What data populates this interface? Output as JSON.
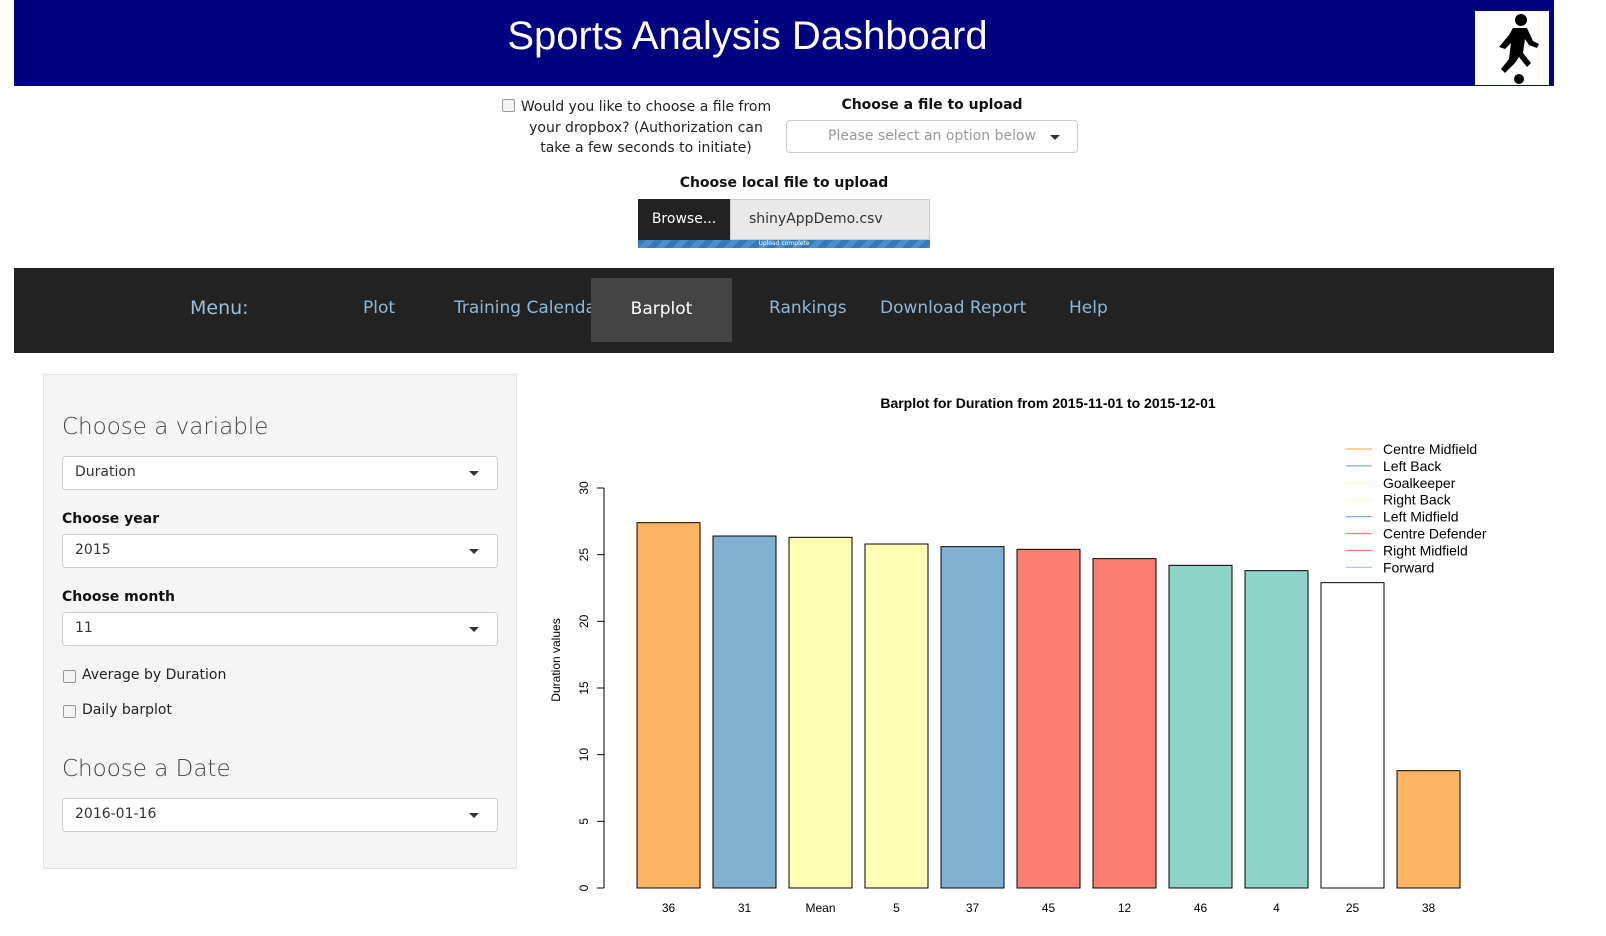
{
  "header": {
    "title": "Sports Analysis Dashboard",
    "logo_icon": "football-player-icon"
  },
  "upload": {
    "dropbox_label": "Would you like to choose a file from your dropbox? (Authorization can take a few seconds to initiate)",
    "dropbox_checked": false,
    "choose_file_label": "Choose a file to upload",
    "choose_file_placeholder": "Please select an option below",
    "local_file_label": "Choose local file to upload",
    "browse_label": "Browse...",
    "file_name": "shinyAppDemo.csv",
    "progress_text": "Upload complete",
    "progress": 1.0
  },
  "nav": {
    "menu_label": "Menu:",
    "items": [
      "Plot",
      "Training Calendar",
      "Barplot",
      "Rankings",
      "Download Report",
      "Help"
    ],
    "active": "Barplot"
  },
  "sidebar": {
    "variable_heading": "Choose a variable",
    "variable_value": "Duration",
    "year_label": "Choose year",
    "year_value": "2015",
    "month_label": "Choose month",
    "month_value": "11",
    "avg_label": "Average by Duration",
    "avg_checked": false,
    "daily_label": "Daily barplot",
    "daily_checked": false,
    "date_heading": "Choose a Date",
    "date_value": "2016-01-16"
  },
  "chart_data": {
    "type": "bar",
    "title": "Barplot for Duration from 2015-11-01 to 2015-12-01",
    "xlabel": "",
    "ylabel": "Duration values",
    "ylim": [
      0,
      30
    ],
    "yticks": [
      0,
      5,
      10,
      15,
      20,
      25,
      30
    ],
    "categories": [
      "36",
      "31",
      "Mean",
      "5",
      "37",
      "45",
      "12",
      "46",
      "4",
      "25",
      "38"
    ],
    "values": [
      27.4,
      26.4,
      26.3,
      25.8,
      25.6,
      25.4,
      24.7,
      24.2,
      23.8,
      22.9,
      8.8
    ],
    "bar_colors": [
      "#FDB462",
      "#80B1D3",
      "#FFFFB3",
      "#FFFFB3",
      "#80B1D3",
      "#FB8072",
      "#FB8072",
      "#8DD3C7",
      "#8DD3C7",
      "#FFFFFF",
      "#FDB462"
    ],
    "legend_position": "top-right",
    "legend": [
      {
        "name": "Centre Midfield",
        "color": "#FDB462"
      },
      {
        "name": "Left Back",
        "color": "#80B1D3"
      },
      {
        "name": "Goalkeeper",
        "color": "#FFFFB3"
      },
      {
        "name": "Right Back",
        "color": "#FFFFB3"
      },
      {
        "name": "Left Midfield",
        "color": "#80B1D3"
      },
      {
        "name": "Centre Defender",
        "color": "#FB8072"
      },
      {
        "name": "Right Midfield",
        "color": "#FB8072"
      },
      {
        "name": "Forward",
        "color": "#8DD3C7"
      }
    ]
  }
}
